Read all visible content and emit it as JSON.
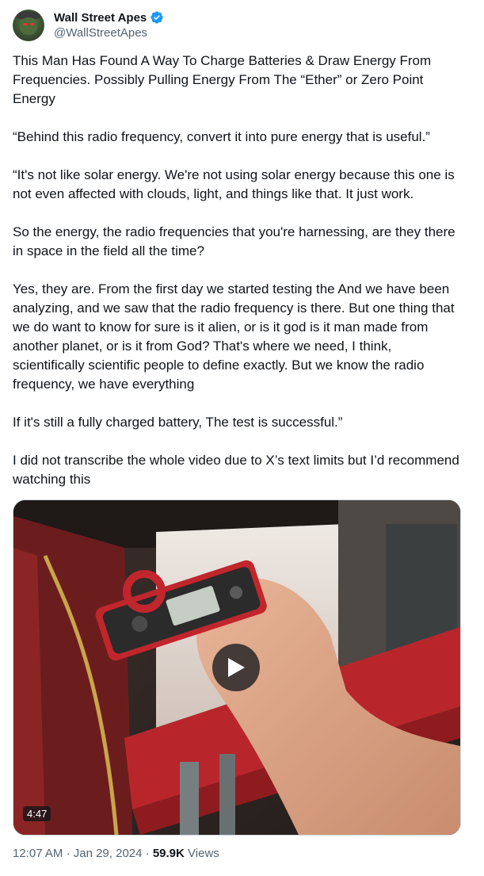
{
  "author": {
    "name": "Wall Street Apes",
    "handle": "@WallStreetApes"
  },
  "tweet": {
    "paragraphs": [
      "This Man Has Found A Way To Charge Batteries & Draw Energy From Frequencies. Possibly Pulling Energy From The “Ether” or Zero Point Energy",
      "“Behind this radio frequency, convert it into pure energy that is useful.”",
      "“It's not like solar energy. We're not using solar energy because this one is not even affected with clouds, light, and things like that. It just work.",
      "So the energy, the radio frequencies that you're harnessing, are they there in space in the field all the time?",
      "Yes, they are. From the first day we started testing the And we have been analyzing, and we saw that the radio frequency is there. But one thing that we do want to know for sure is it alien, or is it god is it man made from another planet, or is it from God? That's where we need, I think, scientifically scientific people to define exactly. But we know the radio frequency, we have everything",
      "If it's still a fully charged battery, The test is successful.”",
      "I did not transcribe the whole video due to X’s text limits but I’d recommend watching this"
    ]
  },
  "video": {
    "duration": "4:47"
  },
  "meta": {
    "time": "12:07 AM",
    "separator": "·",
    "date": "Jan 29, 2024",
    "views_count": "59.9K",
    "views_label": "Views"
  },
  "colors": {
    "verified": "#1d9bf0",
    "secondary_text": "#536471",
    "primary_text": "#0f1419"
  },
  "icons": {
    "verified": "verified-badge-icon",
    "play": "play-icon"
  }
}
